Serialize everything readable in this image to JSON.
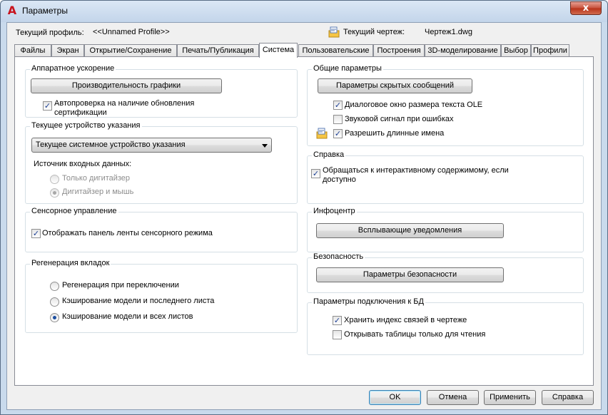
{
  "window": {
    "title": "Параметры",
    "close_glyph": "x"
  },
  "header": {
    "profile_label": "Текущий профиль:",
    "profile_value": "<<Unnamed Profile>>",
    "drawing_label": "Текущий чертеж:",
    "drawing_value": "Чертеж1.dwg"
  },
  "tabs": [
    {
      "label": "Файлы"
    },
    {
      "label": "Экран"
    },
    {
      "label": "Открытие/Сохранение"
    },
    {
      "label": "Печать/Публикация"
    },
    {
      "label": "Система",
      "active": true
    },
    {
      "label": "Пользовательские"
    },
    {
      "label": "Построения"
    },
    {
      "label": "3D-моделирование"
    },
    {
      "label": "Выбор"
    },
    {
      "label": "Профили"
    }
  ],
  "hardware": {
    "title": "Аппаратное ускорение",
    "button": "Производительность графики",
    "check_label": "Автопроверка на наличие обновления сертификации",
    "check_checked": true
  },
  "pointing": {
    "title": "Текущее устройство указания",
    "combo_value": "Текущее системное устройство указания",
    "input_label": "Источник входных данных:",
    "radio1": "Только дигитайзер",
    "radio2": "Дигитайзер и мышь",
    "selected": 2,
    "disabled": true
  },
  "touch": {
    "title": "Сенсорное управление",
    "check_label": "Отображать панель ленты сенсорного режима",
    "check_checked": true
  },
  "regen": {
    "title": "Регенерация вкладок",
    "radio1": "Регенерация при переключении",
    "radio2": "Кэширование модели и последнего листа",
    "radio3": "Кэширование модели и всех листов",
    "selected": 3
  },
  "general": {
    "title": "Общие параметры",
    "button": "Параметры скрытых сообщений",
    "check1": "Диалоговое окно размера текста OLE",
    "check1_checked": true,
    "check2": "Звуковой сигнал при ошибках",
    "check2_checked": false,
    "check3": "Разрешить длинные имена",
    "check3_checked": true
  },
  "help": {
    "title": "Справка",
    "check_label": "Обращаться к интерактивному содержимому, если доступно",
    "check_checked": true
  },
  "infocenter": {
    "title": "Инфоцентр",
    "button": "Всплывающие уведомления"
  },
  "security": {
    "title": "Безопасность",
    "button": "Параметры безопасности"
  },
  "db": {
    "title": "Параметры подключения к БД",
    "check1": "Хранить индекс связей в чертеже",
    "check1_checked": true,
    "check2": "Открывать таблицы только для чтения",
    "check2_checked": false
  },
  "footer": {
    "ok": "OK",
    "cancel": "Отмена",
    "apply": "Применить",
    "help": "Справка"
  },
  "check_glyph": "✓",
  "colors": {
    "window_frame": "#c9daec",
    "client_bg": "#f0f0f0",
    "close_button": "#c7503a",
    "check_mark": "#1c3f94",
    "app_icon": "#c8141e"
  }
}
